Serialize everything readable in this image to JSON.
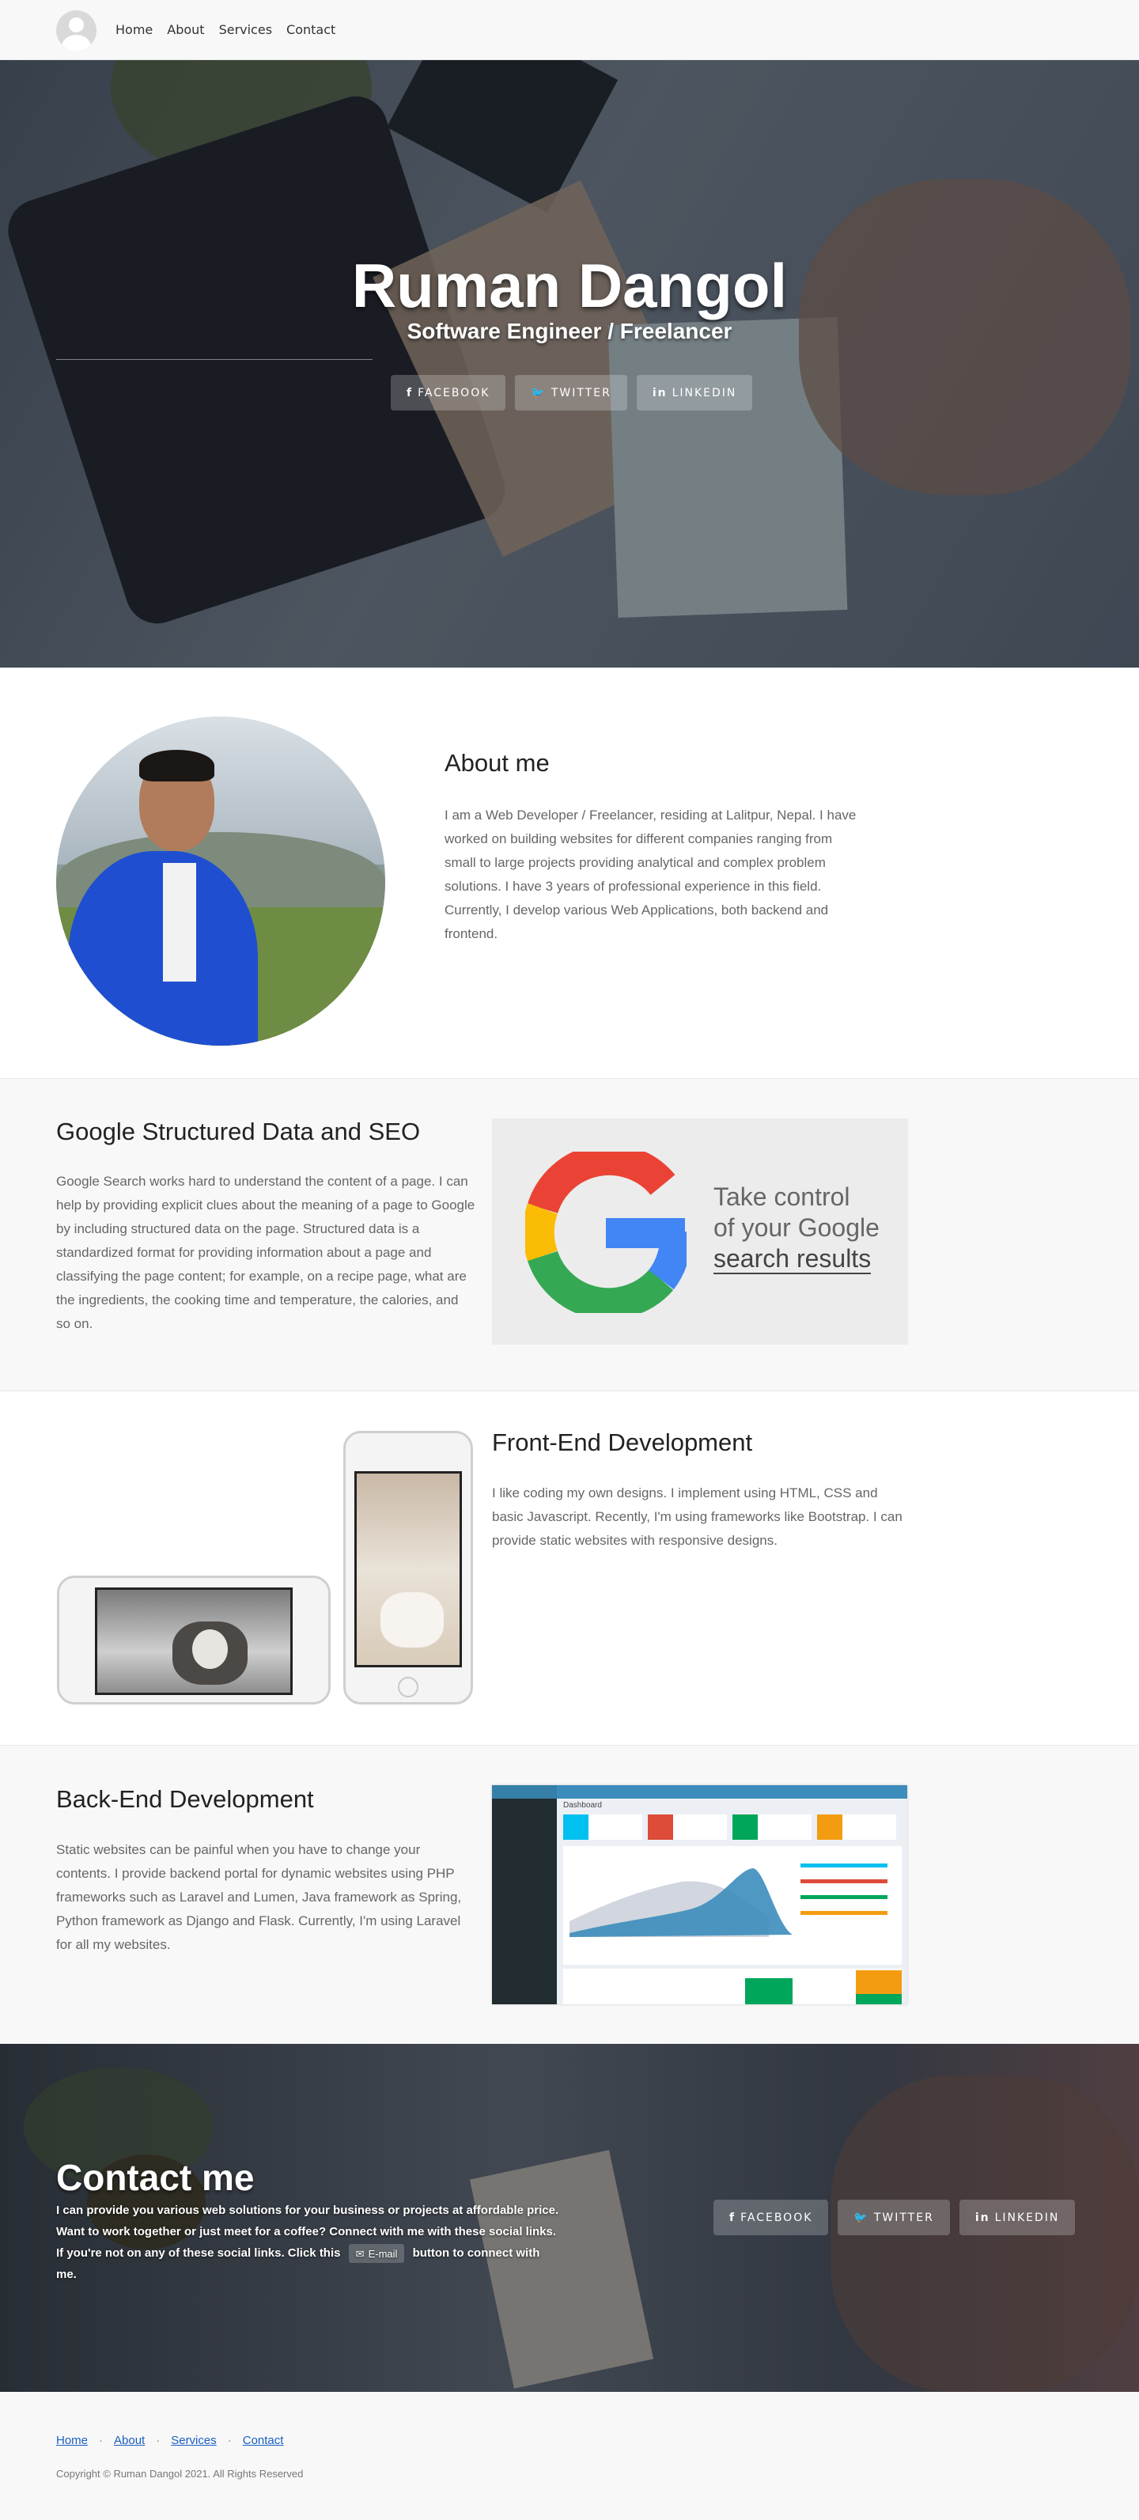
{
  "nav": {
    "items": [
      "Home",
      "About",
      "Services",
      "Contact"
    ]
  },
  "hero": {
    "name": "Ruman Dangol",
    "subtitle": "Software Engineer / Freelancer",
    "social": [
      {
        "icon": "facebook-icon",
        "glyph": "f",
        "label": "FACEBOOK"
      },
      {
        "icon": "twitter-icon",
        "glyph": "🐦",
        "label": "TWITTER"
      },
      {
        "icon": "linkedin-icon",
        "glyph": "in",
        "label": "LINKEDIN"
      }
    ]
  },
  "about": {
    "title": "About me",
    "text": "I am a Web Developer / Freelancer, residing at Lalitpur, Nepal. I have worked on building websites for different companies ranging from small to large projects providing analytical and complex problem solutions. I have 3 years of professional experience in this field. Currently, I develop various Web Applications, both backend and frontend."
  },
  "seo": {
    "title": "Google Structured Data and SEO",
    "text": "Google Search works hard to understand the content of a page. I can help by providing explicit clues about the meaning of a page to Google by including structured data on the page. Structured data is a standardized format for providing information about a page and classifying the page content; for example, on a recipe page, what are the ingredients, the cooking time and temperature, the calories, and so on.",
    "image_line1": "Take control",
    "image_line2": "of your Google",
    "image_line3": "search results"
  },
  "frontend": {
    "title": "Front-End Development",
    "text": "I like coding my own designs. I implement using HTML, CSS and basic Javascript. Recently, I'm using frameworks like Bootstrap. I can provide static websites with responsive designs."
  },
  "backend": {
    "title": "Back-End Development",
    "text": "Static websites can be painful when you have to change your contents. I provide backend portal for dynamic websites using PHP frameworks such as Laravel and Lumen, Java framework as Spring, Python framework as Django and Flask. Currently, I'm using Laravel for all my websites.",
    "dashboard_title": "Dashboard"
  },
  "contact": {
    "title": "Contact me",
    "text_before": "I can provide you various web solutions for your business or projects at affordable price. Want to work together or just meet for a coffee? Connect with me with these social links. If you're not on any of these social links. Click this",
    "email_label": "E-mail",
    "text_after": "button to connect with me."
  },
  "footer": {
    "copyright": "Copyright © Ruman Dangol 2021. All Rights Reserved"
  },
  "colors": {
    "link": "#1a5fc1",
    "google_red": "#EA4335",
    "google_yellow": "#FBBC05",
    "google_green": "#34A853",
    "google_blue": "#4285F4"
  }
}
